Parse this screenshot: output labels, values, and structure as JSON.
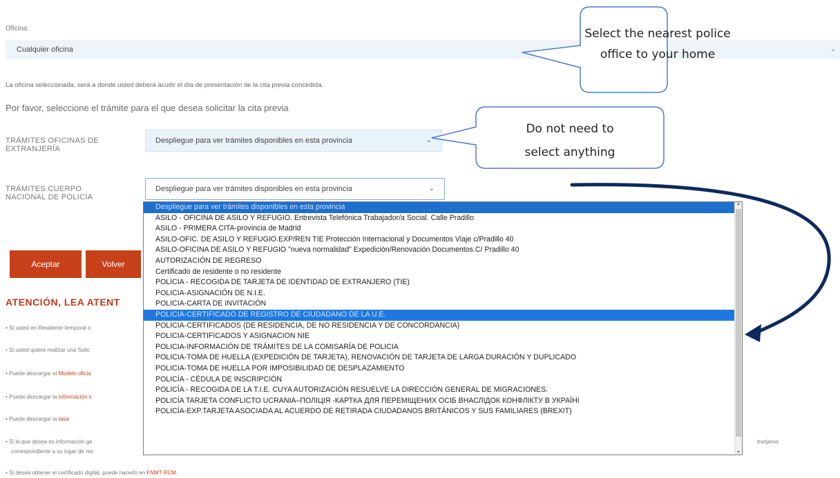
{
  "office": {
    "label": "Oficina:",
    "value": "Cualquier oficina",
    "note": "La oficina seleccionada, será a donde usted deberá acudir el día de presentación de la cita previa concedida."
  },
  "prompt": "Por favor, seleccione el trámite para el que desea solicitar la cita previa",
  "tramites_extranjeria": {
    "label_line1": "TRÁMITES OFICINAS DE",
    "label_line2": "EXTRANJERÍA",
    "value": "Despliegue para ver trámites disponibles en esta provincia"
  },
  "tramites_policia": {
    "label_line1": "TRÁMITES CUERPO",
    "label_line2": "NACIONAL DE POLICÍA",
    "value": "Despliegue para ver trámites disponibles en esta provincia",
    "options": [
      "Despliegue para ver trámites disponibles en esta provincia",
      "ASILO - OFICINA DE ASILO Y REFUGIO. Entrevista Telefónica Trabajador/a Social. Calle Pradillo",
      "ASILO - PRIMERA CITA-provincia de Madrid",
      "ASILO-OFIC. DE ASILO Y REFUGIO.EXP/REN TIE Protección Internacional y Documentos Viaje c/Pradillo 40",
      "ASILO-OFICINA DE ASILO Y REFUGIO \"nueva normalidad\" Expedición/Renovación Documentos.C/ Pradillo 40",
      "AUTORIZACIÓN DE REGRESO",
      "Certificado de residente o no residente",
      "POLICIA - RECOGIDA DE TARJETA DE IDENTIDAD DE EXTRANJERO (TIE)",
      "POLICIA-ASIGNACIÓN DE N.I.E.",
      "POLICIA-CARTA DE INVITACIÓN",
      "POLICIA-CERTIFICADO DE REGISTRO DE CIUDADANO DE LA U.E.",
      "POLICIA-CERTIFICADOS (DE RESIDENCIA, DE NO RESIDENCIA Y DE CONCORDANCIA)",
      "POLICIA-CERTIFICADOS Y ASIGNACION NIE",
      "POLICIA-INFORMACIÓN DE TRÁMITES DE LA COMISARÍA DE POLICIA",
      "POLICIA-TOMA DE HUELLA (EXPEDICIÓN DE TARJETA), RENOVACIÓN DE TARJETA DE LARGA DURACIÓN Y DUPLICADO",
      "POLICIA-TOMA DE HUELLA POR IMPOSIBILIDAD DE DESPLAZAMIENTO",
      "POLICÍA - CÉDULA DE INSCRIPCIÓN",
      "POLICÍA - RECOGIDA DE LA T.I.E. CUYA AUTORIZACIÓN RESUELVE LA DIRECCIÓN GENERAL DE MIGRACIONES.",
      "POLICÍA TARJETA CONFLICTO UCRANIA–ПОЛІЦІЯ -КАРТКА ДЛЯ ПЕРЕМІЩЕНИХ ОСІБ ВНАСЛІДОК КОНФЛІКТУ В УКРАЇНІ",
      "POLICÍA-EXP.TARJETA ASOCIADA AL ACUERDO DE RETIRADA CIUDADANOS BRITÁNICOS Y SUS FAMILIARES (BREXIT)"
    ],
    "highlighted_index": 10
  },
  "buttons": {
    "accept": "Aceptar",
    "back": "Volver"
  },
  "attention_title": "ATENCIÓN, LEA ATENT",
  "bullets": [
    {
      "text": "Si usted en Residente temporal o",
      "link": ""
    },
    {
      "text": "Si usted quiere realizar una Solic",
      "link": ""
    },
    {
      "text": "Puede descargar el ",
      "link": "Modelo oficia"
    },
    {
      "text": "Puede descargar la ",
      "link": "Información s"
    },
    {
      "text": "Puede descargar la ",
      "link": "tasa"
    },
    {
      "text": "Si lo que desea es información ge",
      "link": ""
    }
  ],
  "bullet6_line2": "correspondiente a su lugar de res",
  "bullet6_tail": "tranjeros",
  "last_bullet": {
    "text": "Si desea obtener el certificado digital, puede hacerlo en ",
    "link": "FNMT-RCM."
  },
  "callouts": {
    "office_line1": "Select the nearest police",
    "office_line2": "office to your home",
    "tramites_line1": "Do not need to",
    "tramites_line2": "select anything"
  },
  "colors": {
    "accent": "#c7401a",
    "highlight": "#1f78e0",
    "callout_border": "#4a7cc4",
    "arrow": "#0d2a5c"
  }
}
